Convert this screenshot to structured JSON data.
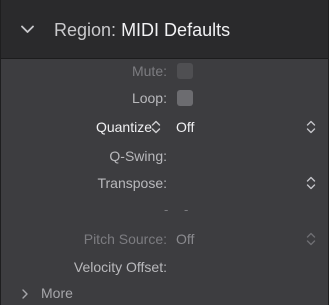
{
  "header": {
    "prefix": "Region:",
    "name": "MIDI Defaults",
    "icon": "chevron-down-icon"
  },
  "rows": {
    "mute": {
      "label": "Mute:",
      "checked": false
    },
    "loop": {
      "label": "Loop:",
      "checked": false
    },
    "quantize": {
      "label": "Quantize",
      "value": "Off"
    },
    "qswing": {
      "label": "Q-Swing:"
    },
    "transpose": {
      "label": "Transpose:"
    },
    "dashes": "- -",
    "pitch_source": {
      "label": "Pitch Source:",
      "value": "Off"
    },
    "velocity_offset": {
      "label": "Velocity Offset:"
    }
  },
  "more": {
    "label": "More",
    "icon": "chevron-right-icon"
  },
  "colors": {
    "panel_bg": "#3d3d40",
    "header_bg": "#2a2a2c",
    "text_bright": "#f0f0f2",
    "text_dim": "#7c7c80"
  }
}
